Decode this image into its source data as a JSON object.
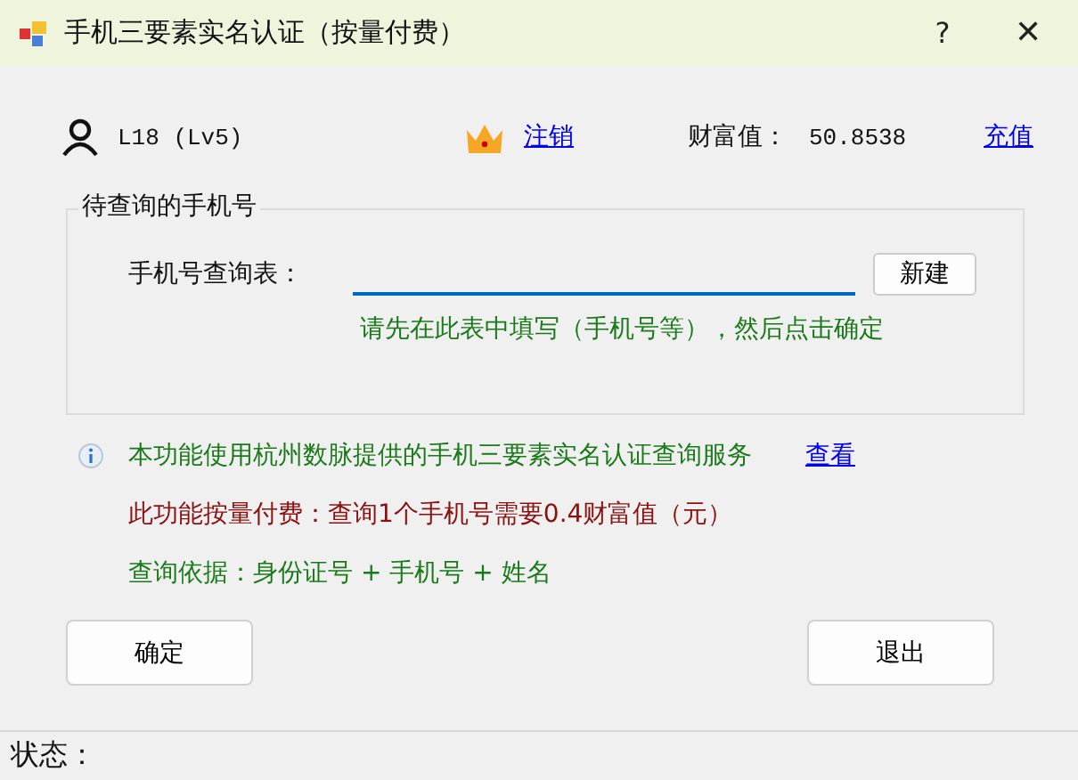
{
  "window": {
    "title": "手机三要素实名认证（按量付费）",
    "help": "?",
    "close": "✕"
  },
  "account": {
    "user": "L18 (Lv5)",
    "logout": "注销",
    "wealth_label": "财富值：",
    "wealth_value": "50.8538",
    "recharge": "充值"
  },
  "group": {
    "title": "待查询的手机号",
    "field_label": "手机号查询表：",
    "new_button": "新建",
    "hint": "请先在此表中填写（手机号等），然后点击确定"
  },
  "notes": [
    {
      "text": "本功能使用杭州数脉提供的手机三要素实名认证查询服务",
      "color": "#1a7a1a",
      "link": "查看"
    },
    {
      "text": "此功能按量付费：查询1个手机号需要0.4财富值（元）",
      "color": "#8b1010"
    },
    {
      "text": "查询依据：身份证号 + 手机号 + 姓名",
      "color": "#1a7a1a"
    }
  ],
  "buttons": [
    "确定",
    "退出"
  ],
  "status_bar": {
    "label": "状态："
  }
}
